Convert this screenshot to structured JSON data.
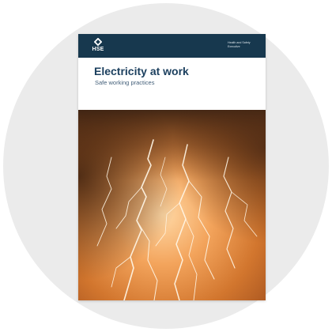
{
  "cover": {
    "logo_text": "HSE",
    "publisher": "Health and Safety Executive",
    "title": "Electricity at work",
    "subtitle": "Safe working practices",
    "header_color": "#17384e",
    "title_color": "#1b3f5e",
    "image": "lightning-storm-illustration"
  },
  "background": {
    "shape": "circle",
    "color": "#ebebeb"
  }
}
